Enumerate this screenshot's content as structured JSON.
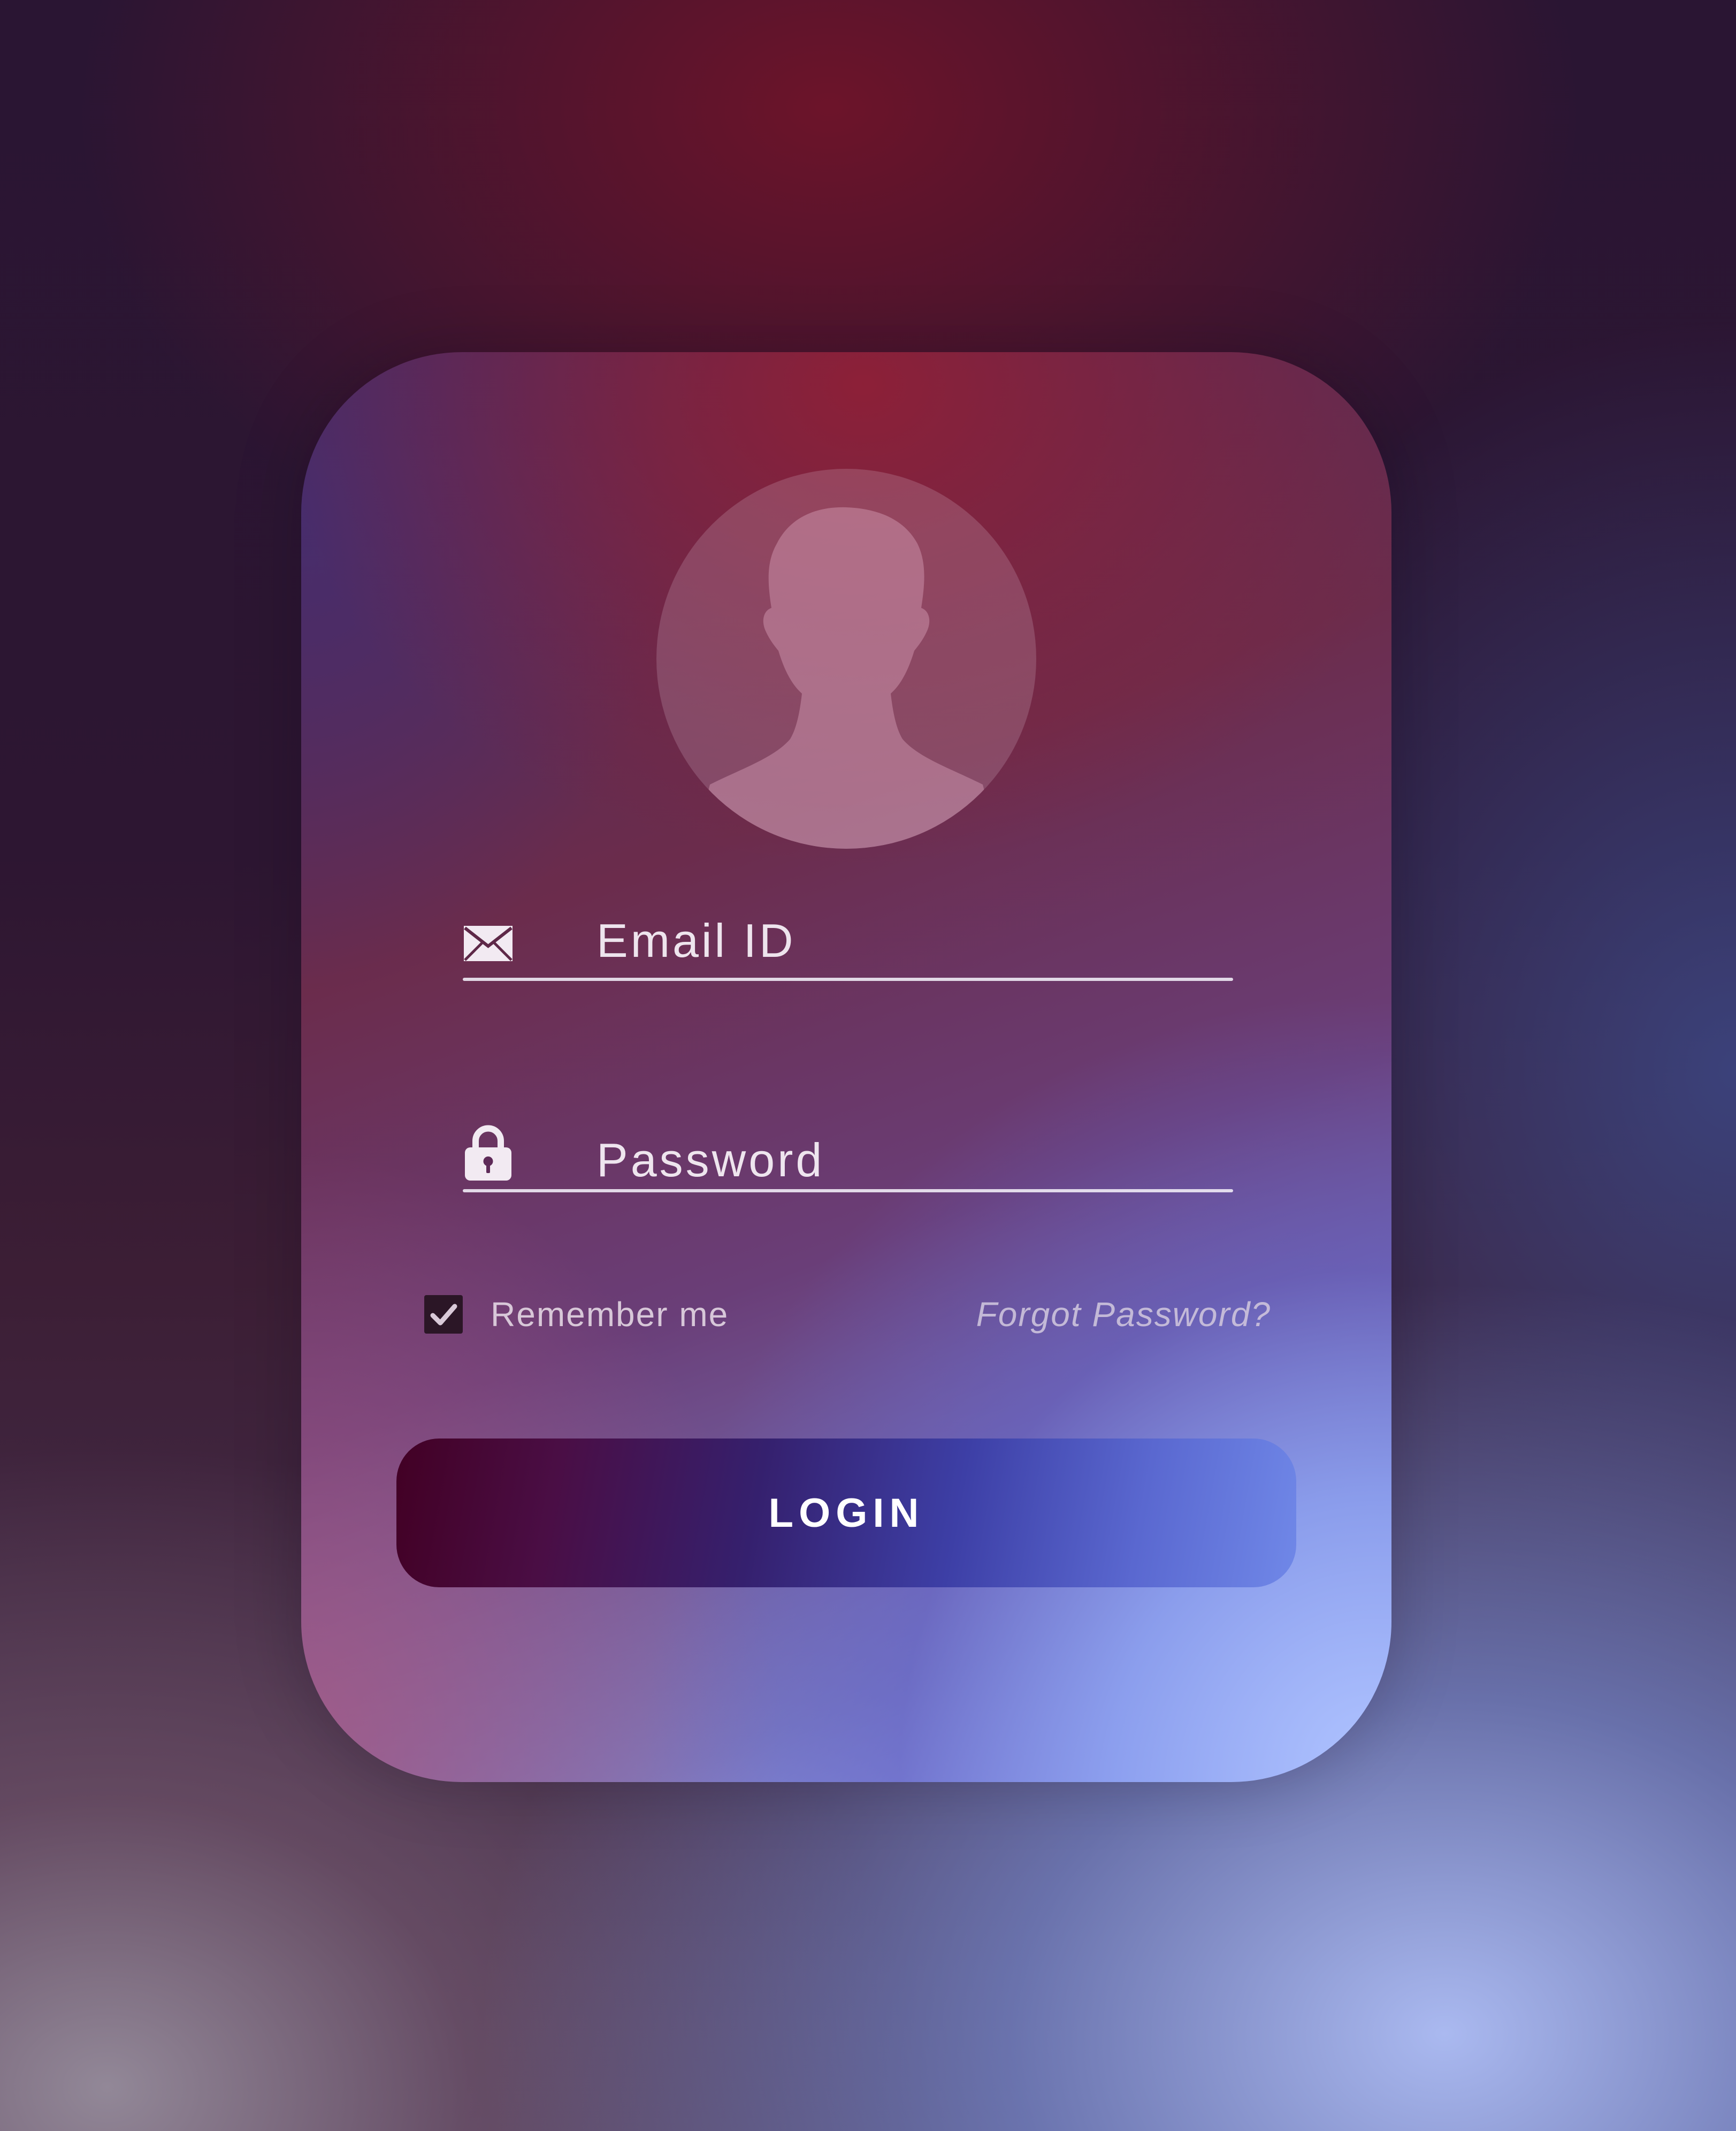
{
  "login_form": {
    "email_placeholder": "Email ID",
    "password_placeholder": "Password",
    "remember_label": "Remember me",
    "remember_checked": true,
    "forgot_label": "Forgot Password?",
    "login_label": "LOGIN"
  },
  "icons": {
    "avatar": "user-silhouette-icon",
    "email": "envelope-icon",
    "password": "lock-icon",
    "checkbox": "checkmark-icon"
  },
  "colors": {
    "button_start": "#420024",
    "button_end": "#7088e8",
    "text": "#f5eef5"
  }
}
